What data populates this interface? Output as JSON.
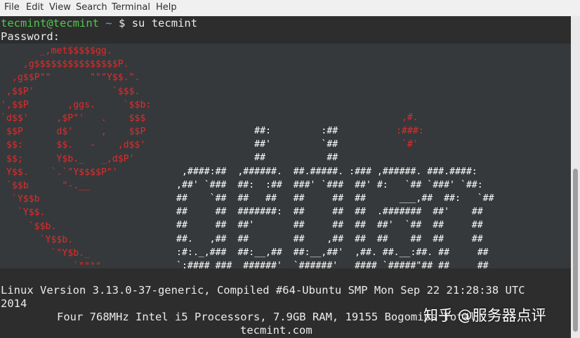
{
  "menu": {
    "items": [
      "File",
      "Edit",
      "View",
      "Search",
      "Terminal",
      "Help"
    ]
  },
  "prompt": {
    "user_host": "tecmint@tecmint",
    "path": "~",
    "symbol": "$",
    "command": "su tecmint"
  },
  "password_prompt": "Password:",
  "debian_logo": {
    "swirl_lines": [
      "       _,met$$$$$gg.",
      "    ,g$$$$$$$$$$$$$$$P.",
      "  ,g$$P\"\"       \"\"\"Y$$.\".",
      " ,$$P'              `$$$.",
      "',$$P       ,ggs.     `$$b:",
      "`d$$'     ,$P\"'   .    $$$",
      " $$P      d$'     ,    $$P",
      " $$:      $$.   -    ,d$$'",
      " $$;      Y$b._   _,d$P'",
      " Y$$.    `.`\"Y$$$$P\"'",
      " `$$b      \"-.__",
      "  `Y$$b",
      "   `Y$$.",
      "     `$$b.",
      "       `Y$$b.",
      "         `\"Y$b._",
      "             `\"\"\"\""
    ],
    "word_lines": [
      "              ##:         :##",
      "              ##'         `##",
      "              ##           ##",
      " ,####:##  ,######.  ##.#####. :### ,######. ###.####:",
      ",##' `###  ##:  :##  ###' `###  ##' #:   `## `###' `##:",
      "##    `##  ##   ##   ##     ##  ##      ___,##  ##:   `##",
      "##     ##  #######:  ##     ##  ##  .#######  ##'    ##",
      "##     ##  ##'       ##     ##  ##  ##'  `##  ##     ##",
      "##.   ,##  ##        ##    ,##  ##  ##    ##  ##     ##",
      ":#:._,###  ##:__,##  ##:__,##'  ,##. ##.__:##. ##     ##",
      "`:#### ###  ######'  `######'   #### `#####\"## ##     ##"
    ],
    "dot_lines": [
      "  ,#.",
      " :###:",
      "  `#'"
    ]
  },
  "system_info": {
    "version_line": "Linux Version 3.13.0-37-generic, Compiled #64-Ubuntu SMP Mon Sep 22 21:28:38 UTC",
    "year_line": "2014",
    "cpu_line": "Four 768MHz Intel i5 Processors, 7.9GB RAM, 19155 Bogomips Total",
    "hostname": "tecmint.com"
  },
  "watermark": "知乎 @服务器点评"
}
